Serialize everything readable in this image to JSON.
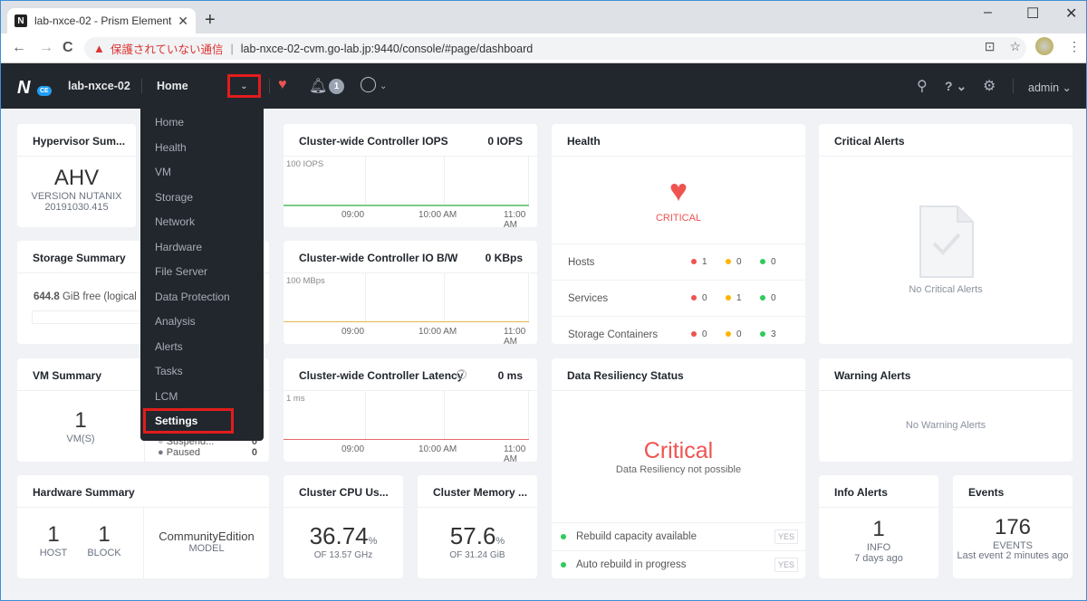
{
  "browser": {
    "tab_title": "lab-nxce-02 - Prism Element",
    "tab_favicon": "N",
    "new_tab": "+",
    "minimize": "–",
    "maximize": "☐",
    "close": "✕",
    "back": "←",
    "forward": "→",
    "reload": "C",
    "security_warning": "保護されていない通信",
    "url": "lab-nxce-02-cvm.go-lab.jp:9440/console/#page/dashboard",
    "translate_icon": "⊡",
    "bookmark_icon": "☆",
    "menu_icon": "⋮"
  },
  "nav": {
    "logo_letter": "N",
    "logo_badge": "CE",
    "cluster_name": "lab-nxce-02",
    "current_page": "Home",
    "dropdown_caret": "⌄",
    "alerts_badge": "1",
    "admin_label": "admin ⌄",
    "help_label": "? ⌄"
  },
  "menu": {
    "items": [
      "Home",
      "Health",
      "VM",
      "Storage",
      "Network",
      "Hardware",
      "File Server",
      "Data Protection",
      "Analysis",
      "Alerts",
      "Tasks",
      "LCM",
      "Settings"
    ],
    "selected": "Settings"
  },
  "hypervisor": {
    "title": "Hypervisor Sum...",
    "name": "AHV",
    "version_line1": "VERSION NUTANIX",
    "version_line2": "20191030.415"
  },
  "storage": {
    "title": "Storage Summary",
    "free_value": "644.8",
    "free_unit": "GiB",
    "free_label": "free (logical"
  },
  "vm": {
    "title": "VM Summary",
    "count": "1",
    "count_label": "VM(S)",
    "suspended_label": "Suspend...",
    "suspended_value": "0",
    "paused_label": "Paused",
    "paused_value": "0"
  },
  "hardware": {
    "title": "Hardware Summary",
    "hosts": "1",
    "hosts_label": "HOST",
    "blocks": "1",
    "blocks_label": "BLOCK",
    "model": "CommunityEdition",
    "model_label": "MODEL"
  },
  "iops": {
    "title": "Cluster-wide Controller IOPS",
    "value": "0 IOPS",
    "ymax": "100 IOPS",
    "color": "#7ccd8a"
  },
  "bw": {
    "title": "Cluster-wide Controller IO B/W",
    "value": "0 KBps",
    "ymax": "100 MBps",
    "color": "#e8b94a"
  },
  "latency": {
    "title": "Cluster-wide Controller Latency",
    "value": "0 ms",
    "ymax": "1 ms",
    "color": "#e46a6a",
    "help": "?"
  },
  "chart_ticks": [
    "09:00",
    "10:00 AM",
    "11:00 AM"
  ],
  "cpu": {
    "title": "Cluster CPU Us...",
    "value": "36.74",
    "unit": "%",
    "of": "OF 13.57 GHz"
  },
  "memory": {
    "title": "Cluster Memory ...",
    "value": "57.6",
    "unit": "%",
    "of": "OF 31.24 GiB"
  },
  "health": {
    "title": "Health",
    "status": "CRITICAL",
    "rows": [
      {
        "name": "Hosts",
        "critical": "1",
        "warning": "0",
        "good": "0"
      },
      {
        "name": "Services",
        "critical": "0",
        "warning": "1",
        "good": "0"
      },
      {
        "name": "Storage Containers",
        "critical": "0",
        "warning": "0",
        "good": "3"
      }
    ],
    "colors": {
      "critical": "#ef5350",
      "warning": "#ffb300",
      "good": "#2ecc5a"
    }
  },
  "resiliency": {
    "title": "Data Resiliency Status",
    "status": "Critical",
    "subtitle": "Data Resiliency not possible",
    "rows": [
      {
        "label": "Rebuild capacity available",
        "value": "YES"
      },
      {
        "label": "Auto rebuild in progress",
        "value": "YES"
      }
    ]
  },
  "critical_alerts": {
    "title": "Critical Alerts",
    "empty": "No Critical Alerts"
  },
  "warning_alerts": {
    "title": "Warning Alerts",
    "empty": "No Warning Alerts"
  },
  "info_alerts": {
    "title": "Info Alerts",
    "count": "1",
    "label": "INFO",
    "time": "7 days ago"
  },
  "events": {
    "title": "Events",
    "count": "176",
    "label": "EVENTS",
    "last": "Last event 2 minutes ago"
  }
}
